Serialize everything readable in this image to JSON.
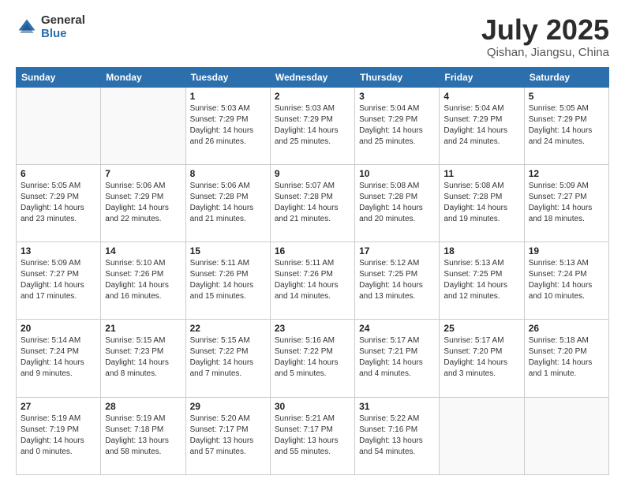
{
  "logo": {
    "general": "General",
    "blue": "Blue"
  },
  "title": {
    "month": "July 2025",
    "location": "Qishan, Jiangsu, China"
  },
  "weekdays": [
    "Sunday",
    "Monday",
    "Tuesday",
    "Wednesday",
    "Thursday",
    "Friday",
    "Saturday"
  ],
  "weeks": [
    [
      {
        "day": "",
        "detail": ""
      },
      {
        "day": "",
        "detail": ""
      },
      {
        "day": "1",
        "detail": "Sunrise: 5:03 AM\nSunset: 7:29 PM\nDaylight: 14 hours and 26 minutes."
      },
      {
        "day": "2",
        "detail": "Sunrise: 5:03 AM\nSunset: 7:29 PM\nDaylight: 14 hours and 25 minutes."
      },
      {
        "day": "3",
        "detail": "Sunrise: 5:04 AM\nSunset: 7:29 PM\nDaylight: 14 hours and 25 minutes."
      },
      {
        "day": "4",
        "detail": "Sunrise: 5:04 AM\nSunset: 7:29 PM\nDaylight: 14 hours and 24 minutes."
      },
      {
        "day": "5",
        "detail": "Sunrise: 5:05 AM\nSunset: 7:29 PM\nDaylight: 14 hours and 24 minutes."
      }
    ],
    [
      {
        "day": "6",
        "detail": "Sunrise: 5:05 AM\nSunset: 7:29 PM\nDaylight: 14 hours and 23 minutes."
      },
      {
        "day": "7",
        "detail": "Sunrise: 5:06 AM\nSunset: 7:29 PM\nDaylight: 14 hours and 22 minutes."
      },
      {
        "day": "8",
        "detail": "Sunrise: 5:06 AM\nSunset: 7:28 PM\nDaylight: 14 hours and 21 minutes."
      },
      {
        "day": "9",
        "detail": "Sunrise: 5:07 AM\nSunset: 7:28 PM\nDaylight: 14 hours and 21 minutes."
      },
      {
        "day": "10",
        "detail": "Sunrise: 5:08 AM\nSunset: 7:28 PM\nDaylight: 14 hours and 20 minutes."
      },
      {
        "day": "11",
        "detail": "Sunrise: 5:08 AM\nSunset: 7:28 PM\nDaylight: 14 hours and 19 minutes."
      },
      {
        "day": "12",
        "detail": "Sunrise: 5:09 AM\nSunset: 7:27 PM\nDaylight: 14 hours and 18 minutes."
      }
    ],
    [
      {
        "day": "13",
        "detail": "Sunrise: 5:09 AM\nSunset: 7:27 PM\nDaylight: 14 hours and 17 minutes."
      },
      {
        "day": "14",
        "detail": "Sunrise: 5:10 AM\nSunset: 7:26 PM\nDaylight: 14 hours and 16 minutes."
      },
      {
        "day": "15",
        "detail": "Sunrise: 5:11 AM\nSunset: 7:26 PM\nDaylight: 14 hours and 15 minutes."
      },
      {
        "day": "16",
        "detail": "Sunrise: 5:11 AM\nSunset: 7:26 PM\nDaylight: 14 hours and 14 minutes."
      },
      {
        "day": "17",
        "detail": "Sunrise: 5:12 AM\nSunset: 7:25 PM\nDaylight: 14 hours and 13 minutes."
      },
      {
        "day": "18",
        "detail": "Sunrise: 5:13 AM\nSunset: 7:25 PM\nDaylight: 14 hours and 12 minutes."
      },
      {
        "day": "19",
        "detail": "Sunrise: 5:13 AM\nSunset: 7:24 PM\nDaylight: 14 hours and 10 minutes."
      }
    ],
    [
      {
        "day": "20",
        "detail": "Sunrise: 5:14 AM\nSunset: 7:24 PM\nDaylight: 14 hours and 9 minutes."
      },
      {
        "day": "21",
        "detail": "Sunrise: 5:15 AM\nSunset: 7:23 PM\nDaylight: 14 hours and 8 minutes."
      },
      {
        "day": "22",
        "detail": "Sunrise: 5:15 AM\nSunset: 7:22 PM\nDaylight: 14 hours and 7 minutes."
      },
      {
        "day": "23",
        "detail": "Sunrise: 5:16 AM\nSunset: 7:22 PM\nDaylight: 14 hours and 5 minutes."
      },
      {
        "day": "24",
        "detail": "Sunrise: 5:17 AM\nSunset: 7:21 PM\nDaylight: 14 hours and 4 minutes."
      },
      {
        "day": "25",
        "detail": "Sunrise: 5:17 AM\nSunset: 7:20 PM\nDaylight: 14 hours and 3 minutes."
      },
      {
        "day": "26",
        "detail": "Sunrise: 5:18 AM\nSunset: 7:20 PM\nDaylight: 14 hours and 1 minute."
      }
    ],
    [
      {
        "day": "27",
        "detail": "Sunrise: 5:19 AM\nSunset: 7:19 PM\nDaylight: 14 hours and 0 minutes."
      },
      {
        "day": "28",
        "detail": "Sunrise: 5:19 AM\nSunset: 7:18 PM\nDaylight: 13 hours and 58 minutes."
      },
      {
        "day": "29",
        "detail": "Sunrise: 5:20 AM\nSunset: 7:17 PM\nDaylight: 13 hours and 57 minutes."
      },
      {
        "day": "30",
        "detail": "Sunrise: 5:21 AM\nSunset: 7:17 PM\nDaylight: 13 hours and 55 minutes."
      },
      {
        "day": "31",
        "detail": "Sunrise: 5:22 AM\nSunset: 7:16 PM\nDaylight: 13 hours and 54 minutes."
      },
      {
        "day": "",
        "detail": ""
      },
      {
        "day": "",
        "detail": ""
      }
    ]
  ]
}
